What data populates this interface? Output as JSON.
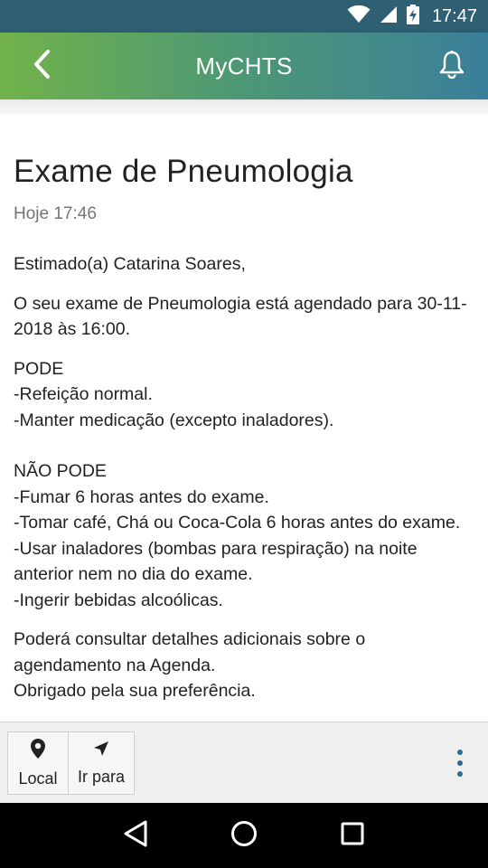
{
  "status_bar": {
    "time": "17:47",
    "icons": [
      "wifi-icon",
      "signal-icon",
      "battery-charging-icon"
    ]
  },
  "app_bar": {
    "title": "MyCHTS",
    "back_icon": "chevron-left-icon",
    "notifications_icon": "bell-icon"
  },
  "message": {
    "title": "Exame de Pneumologia",
    "date": "Hoje 17:46",
    "greeting": "Estimado(a) Catarina Soares,",
    "intro": "O seu exame de Pneumologia está agendado para 30-11-2018 às 16:00.",
    "pode_header": "PODE",
    "pode_items": [
      "-Refeição normal.",
      "-Manter medicação (excepto inaladores)."
    ],
    "nao_pode_header": "NÃO PODE",
    "nao_pode_items": [
      "-Fumar 6 horas antes do exame.",
      "-Tomar café, Chá ou Coca-Cola 6 horas antes do exame.",
      "-Usar inaladores (bombas para respiração) na noite anterior nem no dia do exame.",
      "-Ingerir bebidas alcoólicas."
    ],
    "closing_1": "Poderá consultar detalhes adicionais sobre o agendamento na Agenda.",
    "closing_2": "Obrigado pela sua preferência."
  },
  "bottom_bar": {
    "local_label": "Local",
    "local_icon": "map-pin-icon",
    "ir_para_label": "Ir para",
    "ir_para_icon": "navigation-arrow-icon",
    "more_icon": "more-vertical-icon"
  },
  "nav_bar": {
    "icons": [
      "back-triangle-icon",
      "home-circle-icon",
      "recents-square-icon"
    ]
  },
  "colors": {
    "status_bar": "#2e5f72",
    "app_bar_start": "#72b24a",
    "app_bar_end": "#3a7f9a",
    "accent_dots": "#2e6c93"
  }
}
